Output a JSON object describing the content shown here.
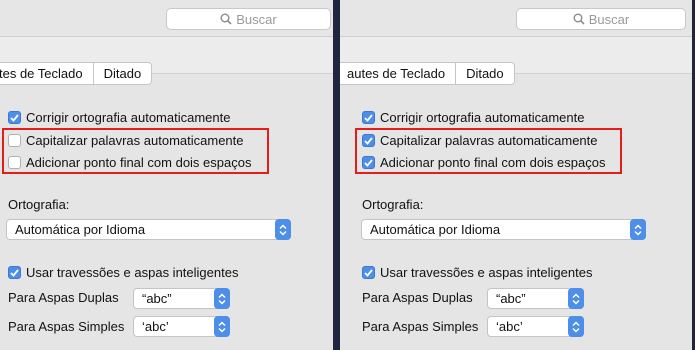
{
  "search": {
    "placeholder": "Buscar"
  },
  "tabs": [
    "Atalhos de Teclado",
    "Ditado"
  ],
  "tabs_left_visible": "tes de Teclado",
  "tabs_right_visible": "autes de Teclado",
  "options": {
    "correct_spelling": "Corrigir ortografia automaticamente",
    "capitalize": "Capitalizar palavras automaticamente",
    "double_space": "Adicionar ponto final com dois espaços",
    "smart_quotes": "Usar travessões e aspas inteligentes"
  },
  "spelling": {
    "label": "Ortografia:",
    "value": "Automática por Idioma"
  },
  "double_quotes": {
    "label": "Para Aspas Duplas",
    "value": "“abc”"
  },
  "single_quotes": {
    "label": "Para Aspas Simples",
    "value": "‘abc’"
  },
  "states": {
    "before": {
      "correct_spelling": true,
      "capitalize": false,
      "double_space": false,
      "smart_quotes": true
    },
    "after": {
      "correct_spelling": true,
      "capitalize": true,
      "double_space": true,
      "smart_quotes": true
    }
  },
  "colors": {
    "accent": "#4d8ee9",
    "highlight": "#e31c1c"
  }
}
